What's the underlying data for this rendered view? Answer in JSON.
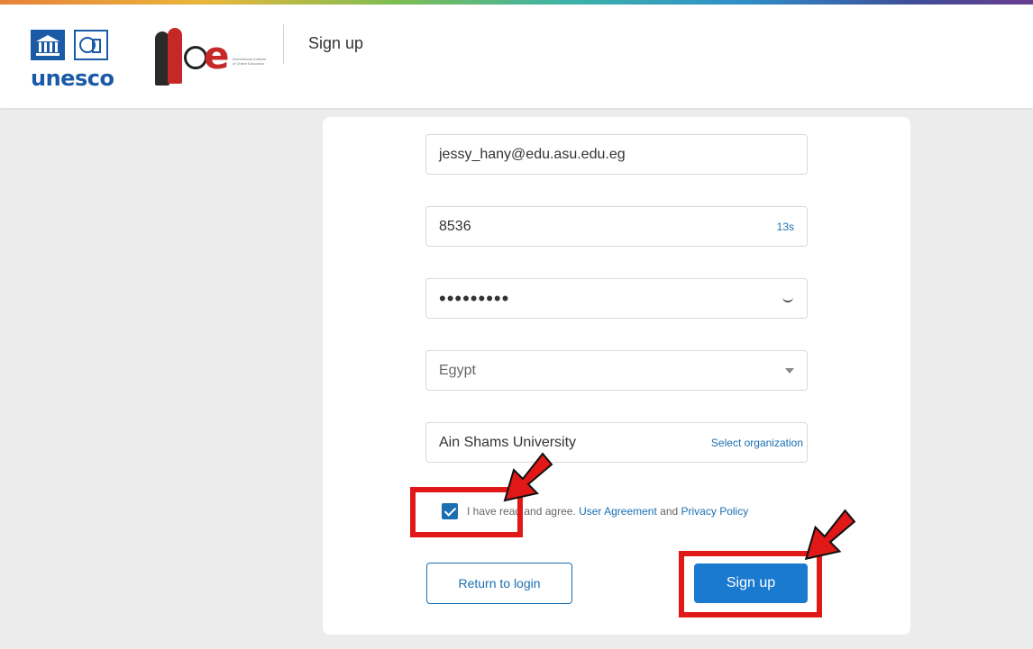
{
  "header": {
    "org_logo_text": "unesco",
    "partner_logo_tiny": "International Institute of Online Education",
    "title": "Sign up"
  },
  "form": {
    "email": {
      "value": "jessy_hany@edu.asu.edu.eg"
    },
    "code": {
      "value": "8536",
      "countdown": "13s"
    },
    "password": {
      "masked": "•••••••••"
    },
    "country": {
      "selected": "Egypt"
    },
    "organization": {
      "value": "Ain Shams University",
      "action": "Select organization"
    },
    "agreement": {
      "checked": true,
      "text_before": "I have read and agree. ",
      "user_agreement": "User Agreement",
      "and": " and ",
      "privacy_policy": "Privacy Policy"
    },
    "return_button": "Return to login",
    "signup_button": "Sign up"
  },
  "colors": {
    "accent": "#1a7ad0",
    "annotation": "#e01818"
  }
}
